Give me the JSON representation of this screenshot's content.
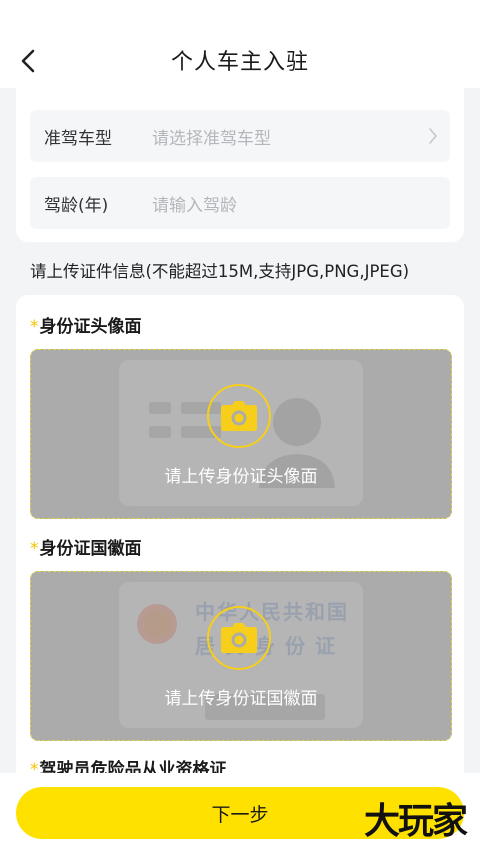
{
  "header": {
    "title": "个人车主入驻"
  },
  "form": {
    "vehicle_type": {
      "label": "准驾车型",
      "placeholder": "请选择准驾车型"
    },
    "driving_years": {
      "label": "驾龄(年)",
      "placeholder": "请输入驾龄"
    }
  },
  "upload_hint": "请上传证件信息(不能超过15M,支持JPG,PNG,JPEG)",
  "uploads": [
    {
      "title": "身份证头像面",
      "button_text": "请上传身份证头像面"
    },
    {
      "title": "身份证国徽面",
      "button_text": "请上传身份证国徽面",
      "card_text_1": "中华人民共和国",
      "card_text_2": "居民身份证"
    },
    {
      "title": "驾驶员危险品从业资格证"
    }
  ],
  "required_mark": "*",
  "next_button": "下一步",
  "watermark": "大玩家",
  "colors": {
    "accent": "#ffe100",
    "star": "#f5c400",
    "camera": "#f7cf1a"
  }
}
